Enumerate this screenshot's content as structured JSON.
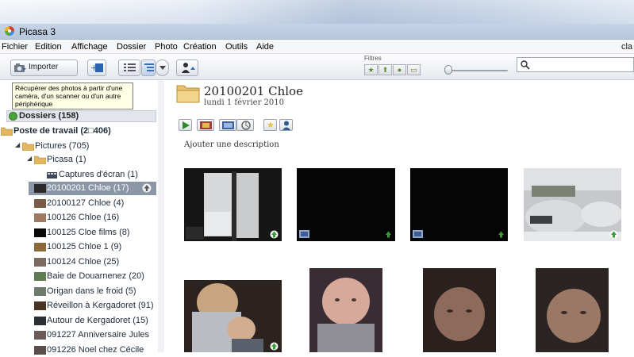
{
  "window": {
    "title": "Picasa 3"
  },
  "menu": {
    "items": [
      "Fichier",
      "Edition",
      "Affichage",
      "Dossier",
      "Photo",
      "Création",
      "Outils",
      "Aide"
    ],
    "right_fragment": "cla"
  },
  "toolbar": {
    "import_label": "Importer",
    "filters_label": "Filtres"
  },
  "tooltip": {
    "text": "Récupérer des photos à partir d'une caméra, d'un scanner ou d'un autre périphérique"
  },
  "sidebar": {
    "hidden_fragment": ")",
    "folders_label": "Dossiers (158)",
    "items": [
      {
        "label": "Poste de travail (2□406)",
        "bold": true
      },
      {
        "label": "Pictures (705)"
      },
      {
        "label": "Picasa (1)"
      },
      {
        "label": "Captures d'écran (1)"
      },
      {
        "label": "20100201 Chloe (17)",
        "selected": true
      },
      {
        "label": "20100127 Chloe (4)"
      },
      {
        "label": "100126 Chloe (16)"
      },
      {
        "label": "100125 Cloe films (8)"
      },
      {
        "label": "100125 Chloe 1 (9)"
      },
      {
        "label": "100124 Chloe (25)"
      },
      {
        "label": "Baie de Douarnenez (20)"
      },
      {
        "label": "Origan dans le froid (5)"
      },
      {
        "label": "Réveillon à Kergadoret (91)"
      },
      {
        "label": "Autour de Kergadoret (15)"
      },
      {
        "label": "091227 Anniversaire Jules"
      },
      {
        "label": "091226 Noel chez Cécile"
      }
    ]
  },
  "album": {
    "title": "20100201 Chloe",
    "date": "lundi 1 février 2010",
    "description_placeholder": "Ajouter une description"
  },
  "icons": [
    "picasa-icon",
    "import-icon",
    "search-icon",
    "star-icon",
    "upload-icon",
    "person-icon",
    "folder-icon",
    "play-icon"
  ],
  "colors": {
    "selection": "#8b97a6",
    "accent_green": "#4aa43a"
  }
}
